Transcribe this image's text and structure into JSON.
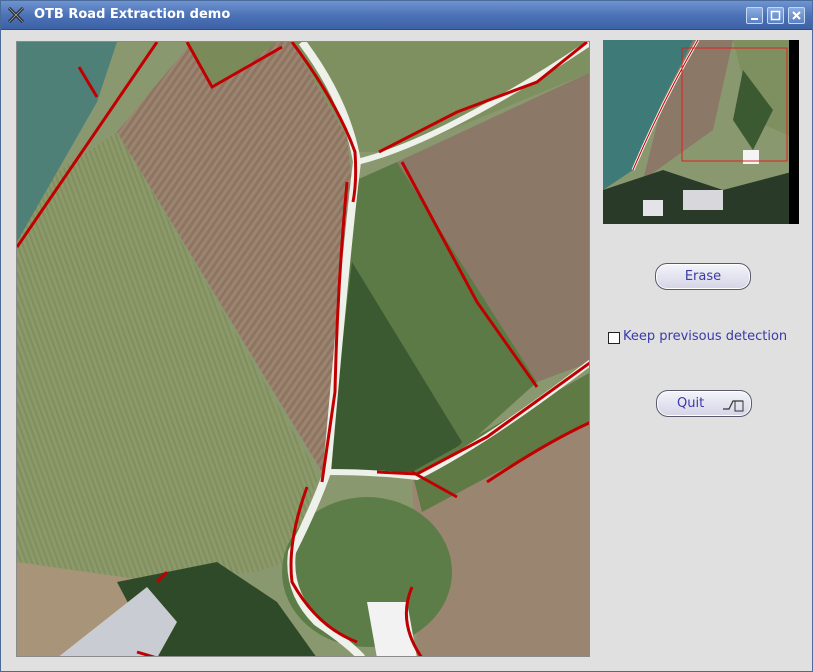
{
  "window": {
    "title": "OTB Road Extraction demo"
  },
  "controls": {
    "erase_label": "Erase",
    "keep_label": "Keep previsous detection",
    "keep_checked": false,
    "quit_label": "Quit"
  },
  "icons": {
    "app": "x-logo-icon",
    "minimize": "minimize-icon",
    "maximize": "maximize-icon",
    "close": "close-icon",
    "quit": "exit-icon"
  },
  "colors": {
    "titlebar": "#4a70b5",
    "road_detection": "#c00000",
    "button_text": "#3a3aa8",
    "overview_frame": "#e02020"
  }
}
